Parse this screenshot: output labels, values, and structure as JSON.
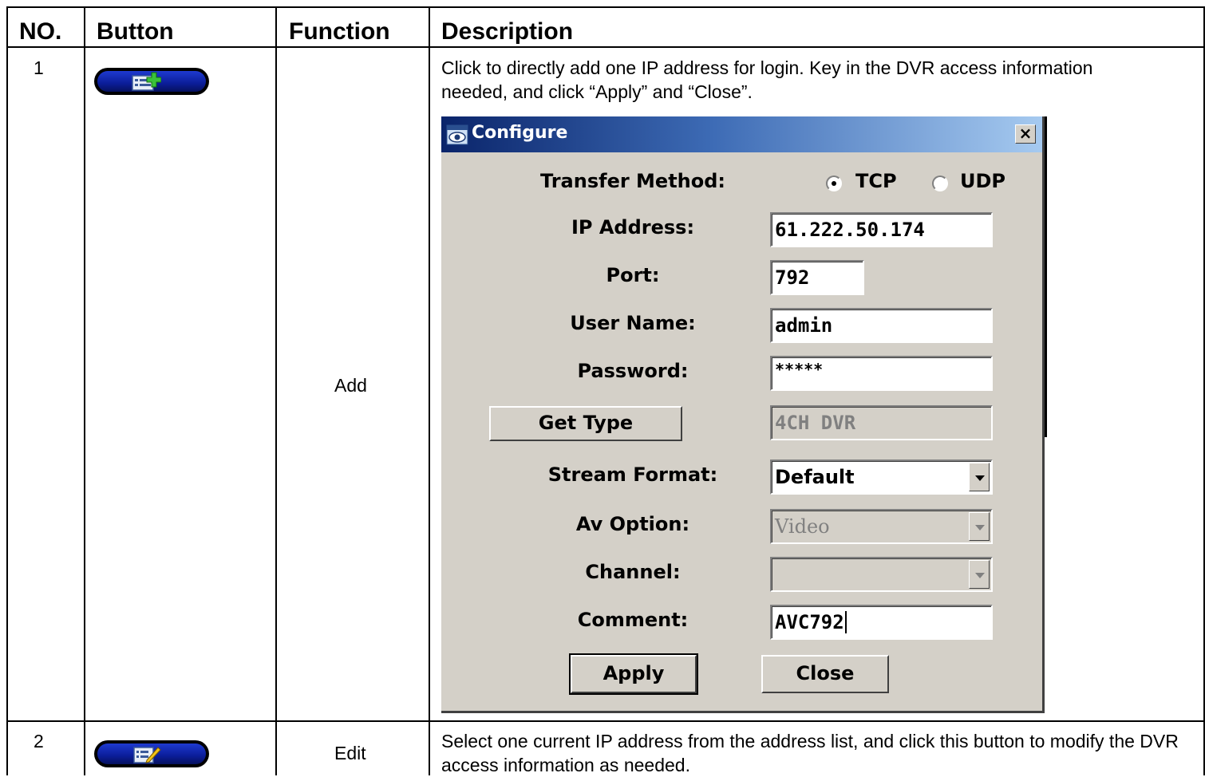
{
  "table": {
    "headers": [
      "NO.",
      "Button",
      "Function",
      "Description"
    ],
    "rows": [
      {
        "no": "1",
        "button_icon": "address-list-add-icon",
        "function": "Add",
        "description": "Click to directly add one IP address for login. Key in the DVR access information needed, and click “Apply” and “Close”."
      },
      {
        "no": "2",
        "button_icon": "address-list-edit-icon",
        "function": "Edit",
        "description": "Select one current IP address from the address list, and click this button to modify the DVR access information as needed."
      }
    ]
  },
  "dialog": {
    "title": "Configure",
    "close_glyph": "×",
    "transfer_method_label": "Transfer Method:",
    "tcp_label": "TCP",
    "udp_label": "UDP",
    "transfer_selected": "TCP",
    "ip_label": "IP Address:",
    "ip_value": "61.222.50.174",
    "port_label": "Port:",
    "port_value": "792",
    "user_label": "User Name:",
    "user_value": "admin",
    "password_label": "Password:",
    "password_value": "*****",
    "get_type_button": "Get Type",
    "type_value": "4CH DVR",
    "stream_format_label": "Stream Format:",
    "stream_format_value": "Default",
    "av_option_label": "Av Option:",
    "av_option_value": "Video",
    "channel_label": "Channel:",
    "channel_value": "",
    "comment_label": "Comment:",
    "comment_value": "AVC792",
    "apply_button": "Apply",
    "close_button": "Close"
  },
  "colors": {
    "pill_blue": "#0b1d99",
    "titlebar_dark": "#0a246a",
    "dialog_face": "#d4d0c8"
  }
}
